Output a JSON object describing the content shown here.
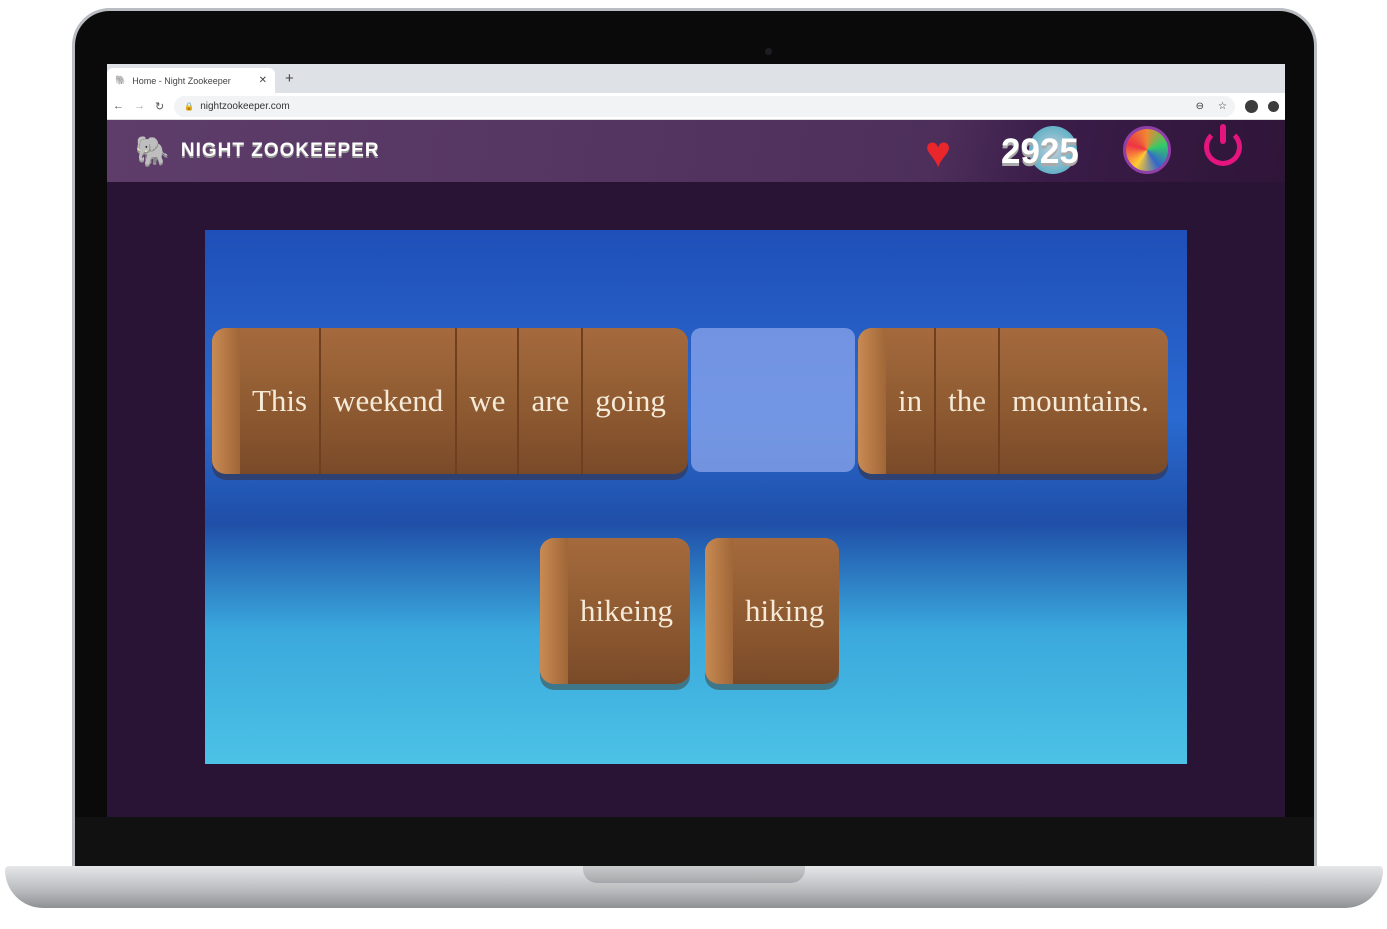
{
  "browser": {
    "tab_title": "Home - Night Zookeeper",
    "url": "nightzookeeper.com"
  },
  "header": {
    "logo_text": "NIGHT ZOOKEEPER",
    "score": "2925"
  },
  "game": {
    "sentence_before": [
      "This",
      "weekend",
      "we",
      "are",
      "going"
    ],
    "sentence_after": [
      "in",
      "the",
      "mountains."
    ],
    "options": [
      "hikeing",
      "hiking"
    ]
  }
}
